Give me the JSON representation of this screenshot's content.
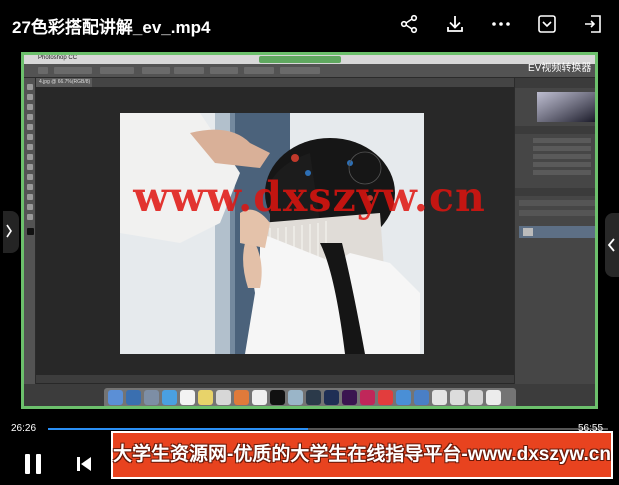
{
  "video": {
    "title": "27色彩搭配讲解_ev_.mp4",
    "current_time": "26:26",
    "total_time": "56:55",
    "progress": 0.464
  },
  "top_actions": [
    "share-icon",
    "download-icon",
    "more-icon",
    "screenshot-icon",
    "exit-fullscreen-icon"
  ],
  "content": {
    "watermark": "www.dxszyw.cn",
    "ev_label": "EV视频转换器",
    "app_name": "Photoshop CC",
    "doc_tab": "4.jpg @ 66.7%(RGB/8)"
  },
  "banner": {
    "text": "大学生资源网-优质的大学生在线指导平台-www.dxszyw.cn"
  },
  "colors": {
    "accent": "#2a8ff5",
    "banner_bg": "#e8431f",
    "frame_border": "#6cc06c",
    "watermark": "#e0140f"
  }
}
